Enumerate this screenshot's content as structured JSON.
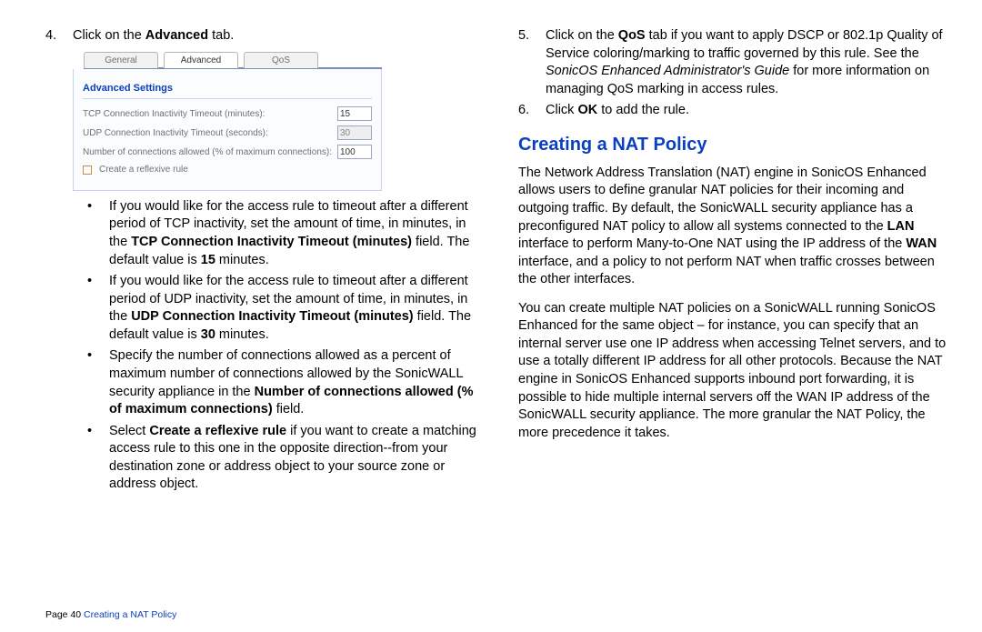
{
  "left": {
    "step4": {
      "num": "4.",
      "pre": "Click on the ",
      "bold": "Advanced",
      "post": " tab."
    },
    "ui": {
      "tabs": {
        "general": "General",
        "advanced": "Advanced",
        "qos": "QoS"
      },
      "heading": "Advanced Settings",
      "row_tcp_label": "TCP Connection Inactivity Timeout (minutes):",
      "row_tcp_value": "15",
      "row_udp_label": "UDP Connection Inactivity Timeout (seconds):",
      "row_udp_value": "30",
      "row_conn_label": "Number of connections allowed (% of maximum connections):",
      "row_conn_value": "100",
      "reflexive_label": "Create a reflexive rule"
    },
    "bullets": {
      "b1_pre": "If you would like for the access rule to timeout after a different period of TCP inactivity, set the amount of time, in minutes, in the ",
      "b1_bold": "TCP Connection Inactivity Timeout (minutes)",
      "b1_mid": " field. The default value is ",
      "b1_bold2": "15",
      "b1_post": " minutes.",
      "b2_pre": "If you would like for the access rule to timeout after a different period of UDP inactivity, set the amount of time, in minutes, in the ",
      "b2_bold": "UDP Connection Inactivity Timeout (minutes)",
      "b2_mid": " field. The default value is ",
      "b2_bold2": "30",
      "b2_post": " minutes.",
      "b3_pre": "Specify the number of connections allowed as a percent of maximum number of connections allowed by the SonicWALL security appliance in the ",
      "b3_bold": "Number of connections allowed (% of maximum connections)",
      "b3_post": " field.",
      "b4_pre": "Select ",
      "b4_bold": "Create a reflexive rule",
      "b4_post": " if you want to create a matching access rule to this one in the opposite direction--from your destination zone or address object to your source zone or address object."
    }
  },
  "right": {
    "step5": {
      "num": "5.",
      "pre": "Click on the ",
      "bold1": "QoS",
      "mid1": " tab if you want to apply DSCP or 802.1p Quality of Service coloring/marking to traffic governed by this rule. See the ",
      "ital": "SonicOS Enhanced Administrator's Guide",
      "post": " for more information on managing QoS marking in access rules."
    },
    "step6": {
      "num": "6.",
      "pre": "Click ",
      "bold": "OK",
      "post": " to add the rule."
    },
    "heading": "Creating a NAT Policy",
    "p1_pre": "The Network Address Translation (NAT) engine in SonicOS Enhanced allows users to define granular NAT policies for their incoming and outgoing traffic. By default, the SonicWALL security appliance has a preconfigured NAT policy to allow all systems connected to the ",
    "p1_b1": "LAN",
    "p1_mid": " interface to perform Many-to-One NAT using the IP address of the ",
    "p1_b2": "WAN",
    "p1_post": " interface, and a policy to not perform NAT when traffic crosses between the other interfaces.",
    "p2": "You can create multiple NAT policies on a SonicWALL running SonicOS Enhanced for the same object – for instance, you can specify that an internal server use one IP address when accessing Telnet servers, and to use a totally different IP address for all other protocols. Because the NAT engine in SonicOS Enhanced supports inbound port forwarding, it is possible to hide multiple internal servers off the WAN IP address of the SonicWALL security appliance. The more granular the NAT Policy, the more precedence it takes."
  },
  "footer": {
    "page": "Page 40  ",
    "link": "Creating a NAT Policy"
  }
}
